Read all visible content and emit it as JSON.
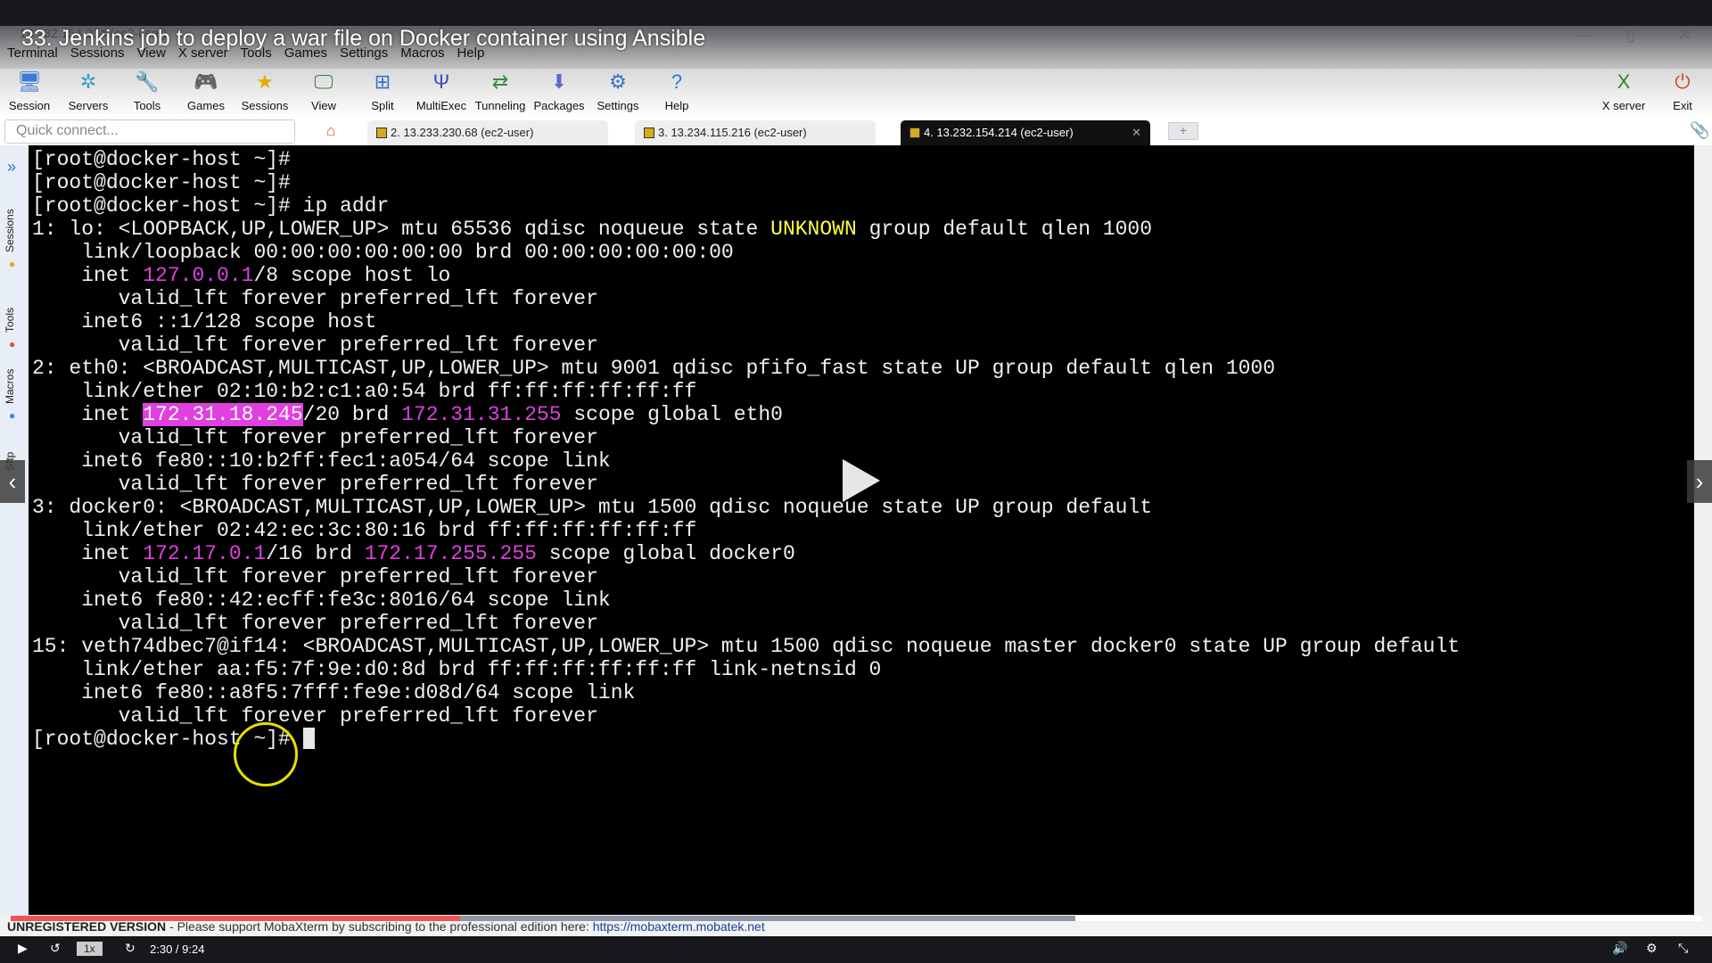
{
  "video": {
    "title": "33. Jenkins job to deploy a war file on Docker container using Ansible",
    "time": "2:30 / 9:24",
    "speed": "1x",
    "progress_fraction": 0.266,
    "buffered_fraction": 0.63
  },
  "window": {
    "title": "13.232.154.214 (ec2-user)"
  },
  "menu": [
    "Terminal",
    "Sessions",
    "View",
    "X server",
    "Tools",
    "Games",
    "Settings",
    "Macros",
    "Help"
  ],
  "toolbar": [
    {
      "label": "Session",
      "icon": "session-icon",
      "glyph": "🖥"
    },
    {
      "label": "Servers",
      "icon": "servers-icon",
      "glyph": "✲"
    },
    {
      "label": "Tools",
      "icon": "tools-icon",
      "glyph": "🔧"
    },
    {
      "label": "Games",
      "icon": "games-icon",
      "glyph": "🎮"
    },
    {
      "label": "Sessions",
      "icon": "star-icon",
      "glyph": "★"
    },
    {
      "label": "View",
      "icon": "view-icon",
      "glyph": "🖵"
    },
    {
      "label": "Split",
      "icon": "split-icon",
      "glyph": "⊞"
    },
    {
      "label": "MultiExec",
      "icon": "multiexec-icon",
      "glyph": "Ψ"
    },
    {
      "label": "Tunneling",
      "icon": "tunneling-icon",
      "glyph": "⇄"
    },
    {
      "label": "Packages",
      "icon": "packages-icon",
      "glyph": "⬇"
    },
    {
      "label": "Settings",
      "icon": "gear-icon",
      "glyph": "⚙"
    },
    {
      "label": "Help",
      "icon": "help-icon",
      "glyph": "?"
    }
  ],
  "toolbar_right": [
    {
      "label": "X server",
      "glyph": "X"
    },
    {
      "label": "Exit",
      "glyph": "⏻"
    }
  ],
  "quick_connect": {
    "placeholder": "Quick connect..."
  },
  "tabs": [
    {
      "label": "2. 13.233.230.68 (ec2-user)"
    },
    {
      "label": "3. 13.234.115.216 (ec2-user)"
    },
    {
      "label": "4. 13.232.154.214 (ec2-user)",
      "active": true
    }
  ],
  "sidebar": [
    "Sessions",
    "Tools",
    "Macros",
    "Sftp"
  ],
  "terminal": [
    [
      [
        "",
        "[root@docker-host ~]#"
      ]
    ],
    [
      [
        "",
        "[root@docker-host ~]#"
      ]
    ],
    [
      [
        "",
        "[root@docker-host ~]# ip addr"
      ]
    ],
    [
      [
        "",
        "1: lo: <LOOPBACK,UP,LOWER_UP> mtu 65536 qdisc noqueue state "
      ],
      [
        "y",
        "UNKNOWN"
      ],
      [
        "",
        " group default qlen 1000"
      ]
    ],
    [
      [
        "",
        "    link/loopback 00:00:00:00:00:00 brd 00:00:00:00:00:00"
      ]
    ],
    [
      [
        "",
        "    inet "
      ],
      [
        "m",
        "127.0.0.1"
      ],
      [
        "",
        "/8 scope host lo"
      ]
    ],
    [
      [
        "",
        "       valid_lft forever preferred_lft forever"
      ]
    ],
    [
      [
        "",
        "    inet6 ::1/128 scope host"
      ]
    ],
    [
      [
        "",
        "       valid_lft forever preferred_lft forever"
      ]
    ],
    [
      [
        "",
        "2: eth0: <BROADCAST,MULTICAST,UP,LOWER_UP> mtu 9001 qdisc pfifo_fast state UP group default qlen 1000"
      ]
    ],
    [
      [
        "",
        "    link/ether 02:10:b2:c1:a0:54 brd ff:ff:ff:ff:ff:ff"
      ]
    ],
    [
      [
        "",
        "    inet "
      ],
      [
        "sel",
        "172.31.18.245"
      ],
      [
        "",
        "/20 brd "
      ],
      [
        "m",
        "172.31.31.255"
      ],
      [
        "",
        " scope global eth0"
      ]
    ],
    [
      [
        "",
        "       valid_lft forever preferred_lft forever"
      ]
    ],
    [
      [
        "",
        "    inet6 fe80::10:b2ff:fec1:a054/64 scope link"
      ]
    ],
    [
      [
        "",
        "       valid_lft forever preferred_lft forever"
      ]
    ],
    [
      [
        "",
        "3: docker0: <BROADCAST,MULTICAST,UP,LOWER_UP> mtu 1500 qdisc noqueue state UP group default"
      ]
    ],
    [
      [
        "",
        "    link/ether 02:42:ec:3c:80:16 brd ff:ff:ff:ff:ff:ff"
      ]
    ],
    [
      [
        "",
        "    inet "
      ],
      [
        "m",
        "172.17.0.1"
      ],
      [
        "",
        "/16 brd "
      ],
      [
        "m",
        "172.17.255.255"
      ],
      [
        "",
        " scope global docker0"
      ]
    ],
    [
      [
        "",
        "       valid_lft forever preferred_lft forever"
      ]
    ],
    [
      [
        "",
        "    inet6 fe80::42:ecff:fe3c:8016/64 scope link"
      ]
    ],
    [
      [
        "",
        "       valid_lft forever preferred_lft forever"
      ]
    ],
    [
      [
        "",
        "15: veth74dbec7@if14: <BROADCAST,MULTICAST,UP,LOWER_UP> mtu 1500 qdisc noqueue master docker0 state UP group default"
      ]
    ],
    [
      [
        "",
        "    link/ether aa:f5:7f:9e:d0:8d brd ff:ff:ff:ff:ff:ff link-netnsid 0"
      ]
    ],
    [
      [
        "",
        "    inet6 fe80::a8f5:7fff:fe9e:d08d/64 scope link"
      ]
    ],
    [
      [
        "",
        "       valid_lft forever preferred_lft forever"
      ]
    ],
    [
      [
        "",
        "[root@docker-host ~]# "
      ]
    ]
  ],
  "status": {
    "label": "UNREGISTERED VERSION",
    "message": "  -  Please support MobaXterm by subscribing to the professional edition here:  ",
    "link": "https://mobaxterm.mobatek.net"
  }
}
